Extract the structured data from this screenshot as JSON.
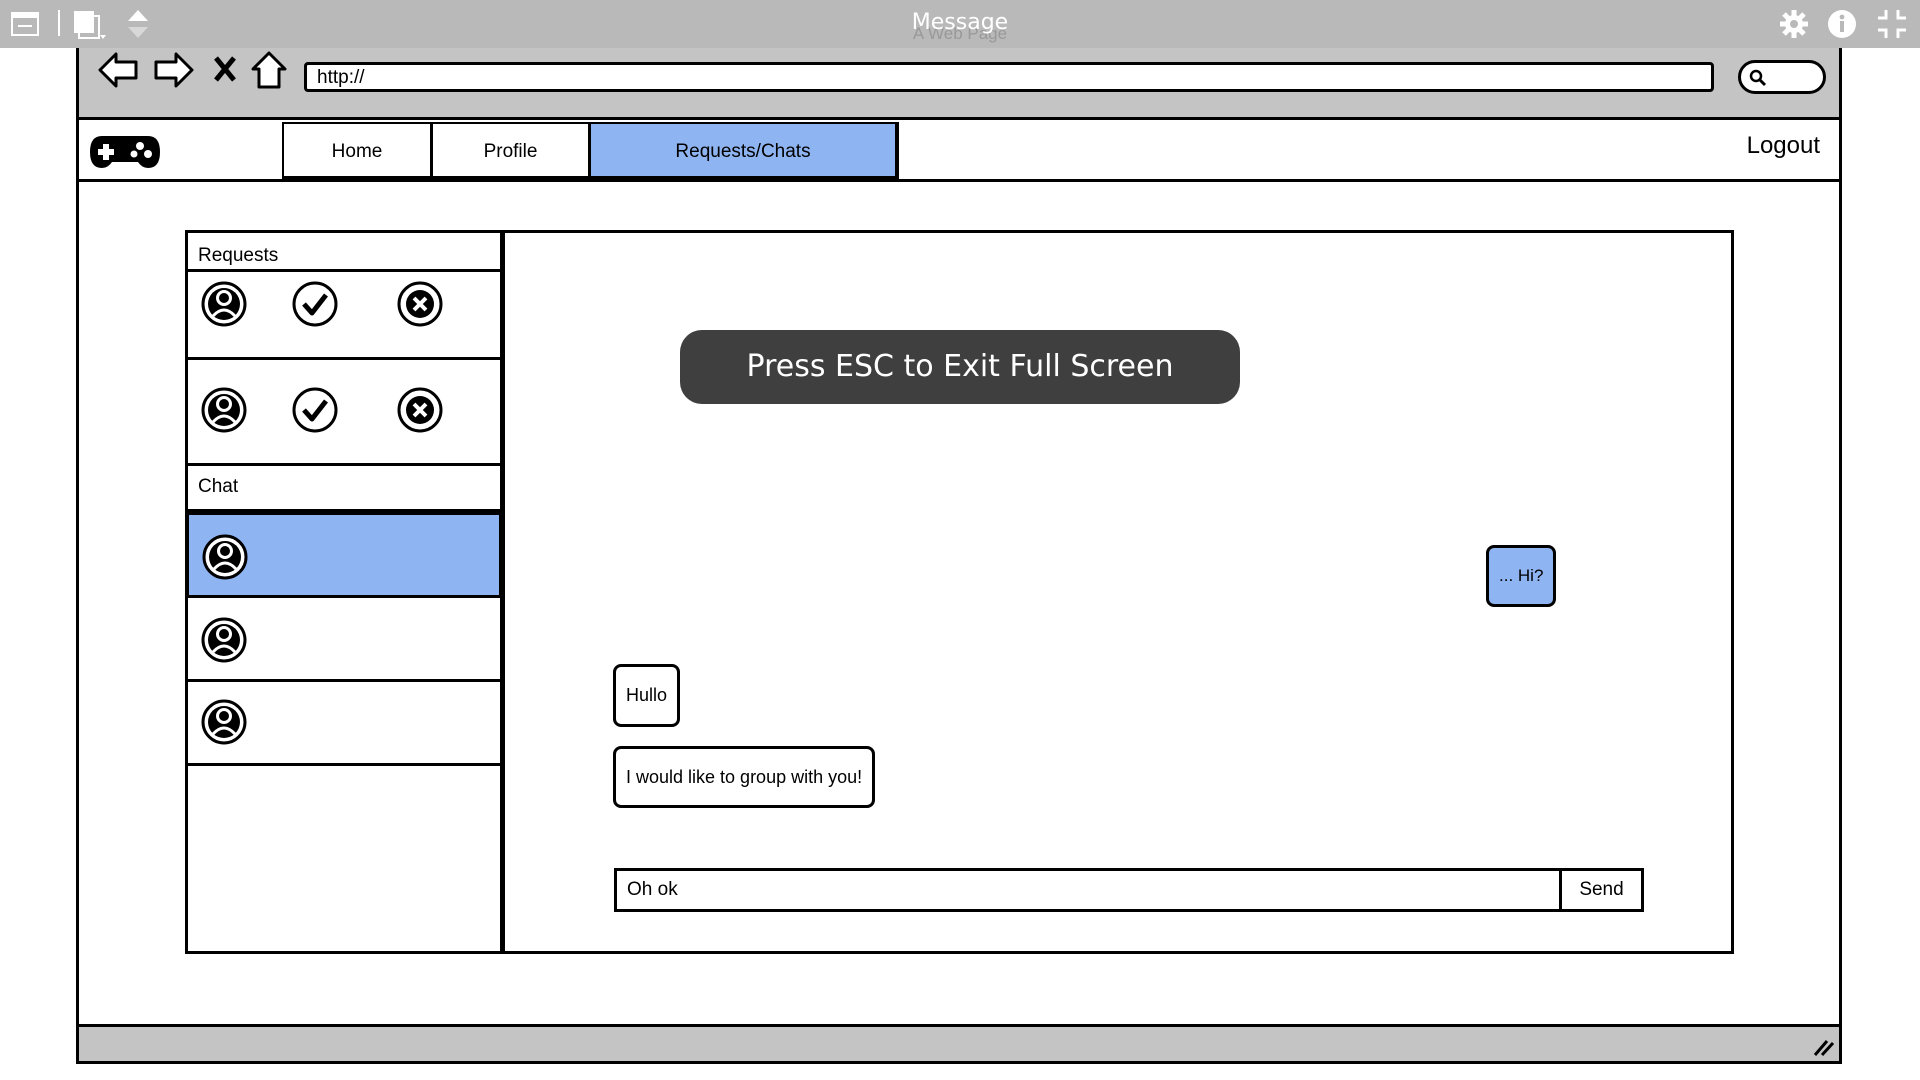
{
  "window": {
    "title": "Message",
    "subtitle": "A Web Page"
  },
  "browser": {
    "address": "http://"
  },
  "nav": {
    "tabs": [
      {
        "label": "Home",
        "active": false
      },
      {
        "label": "Profile",
        "active": false
      },
      {
        "label": "Requests/Chats",
        "active": true
      }
    ],
    "logout": "Logout"
  },
  "sidebar": {
    "requests_header": "Requests",
    "chat_header": "Chat",
    "requests": [
      {
        "avatar": "user-avatar-icon",
        "accept": "check-icon",
        "reject": "close-icon"
      },
      {
        "avatar": "user-avatar-icon",
        "accept": "check-icon",
        "reject": "close-icon"
      }
    ],
    "chats": [
      {
        "avatar": "user-avatar-icon",
        "selected": true
      },
      {
        "avatar": "user-avatar-icon",
        "selected": false
      },
      {
        "avatar": "user-avatar-icon",
        "selected": false
      }
    ]
  },
  "chat": {
    "messages": [
      {
        "text": "... Hi?",
        "from": "me"
      },
      {
        "text": "Hullo",
        "from": "other"
      },
      {
        "text": "I would like to group with you!",
        "from": "other"
      }
    ],
    "input_value": "Oh ok",
    "send_label": "Send"
  },
  "toast": {
    "text": "Press ESC to Exit Full Screen"
  },
  "colors": {
    "accent": "#8fb4f2",
    "chrome": "#c4c4c4",
    "titlebar": "#b9b9b9",
    "toast_bg": "#3f3f3f"
  }
}
